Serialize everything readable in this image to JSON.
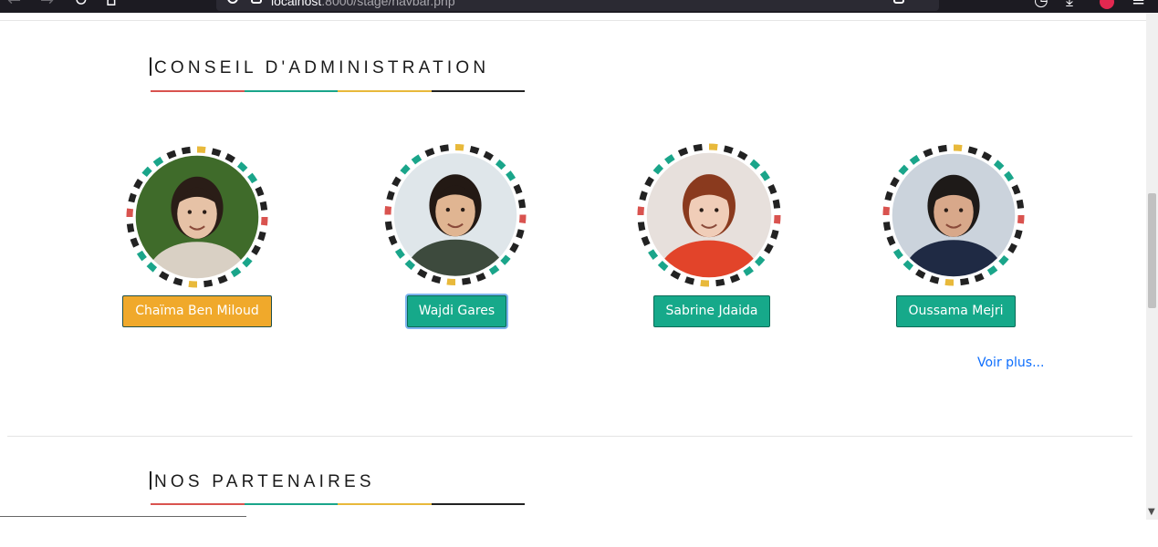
{
  "browser": {
    "url_host": "localhost",
    "url_rest": ":8000/stage/navbar.php"
  },
  "sections": {
    "board": {
      "title": "CONSEIL D'ADMINISTRATION"
    },
    "partners": {
      "title": "NOS PARTENAIRES"
    }
  },
  "underline_colors": [
    "#d9534f",
    "#1aa58a",
    "#e8b93b",
    "#222222"
  ],
  "members": [
    {
      "name": "Chaïma Ben Miloud",
      "button_color": "#f0a92b",
      "photo_bg": "#3f6b2a",
      "skin": "#e6c2a6",
      "hair": "#2a1d17",
      "shirt": "#d9d0c4"
    },
    {
      "name": "Wajdi Gares",
      "button_color": "#16a98a",
      "photo_bg": "#dfe6ea",
      "skin": "#e0b592",
      "hair": "#231914",
      "shirt": "#3d4a3d"
    },
    {
      "name": "Sabrine Jdaida",
      "button_color": "#16a98a",
      "photo_bg": "#e7e0dc",
      "skin": "#f0cdb8",
      "hair": "#8a3a1e",
      "shirt": "#e2442a"
    },
    {
      "name": "Oussama Mejri",
      "button_color": "#16a98a",
      "photo_bg": "#cbd3dc",
      "skin": "#d8a88a",
      "hair": "#1e1a18",
      "shirt": "#1f2a44"
    }
  ],
  "voir_plus": "Voir plus..."
}
